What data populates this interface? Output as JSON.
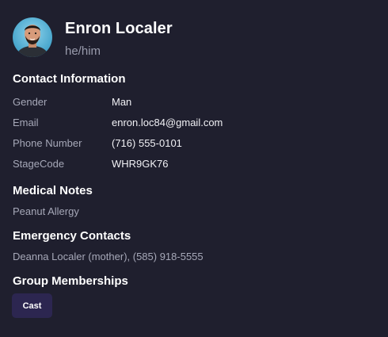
{
  "profile": {
    "name": "Enron Localer",
    "pronouns": "he/him",
    "avatar_icon": "person-photo"
  },
  "contact": {
    "title": "Contact Information",
    "rows": [
      {
        "label": "Gender",
        "value": "Man"
      },
      {
        "label": "Email",
        "value": "enron.loc84@gmail.com"
      },
      {
        "label": "Phone Number",
        "value": "(716) 555-0101"
      },
      {
        "label": "StageCode",
        "value": "WHR9GK76"
      }
    ]
  },
  "medical": {
    "title": "Medical Notes",
    "text": "Peanut Allergy"
  },
  "emergency": {
    "title": "Emergency Contacts",
    "text": "Deanna Localer (mother), (585) 918-5555"
  },
  "groups": {
    "title": "Group Memberships",
    "items": [
      "Cast"
    ]
  },
  "colors": {
    "background": "#1f1f2e",
    "chip": "#2c2650",
    "muted_text": "#a6a8b8",
    "avatar_bg": "#5ab4d6"
  }
}
